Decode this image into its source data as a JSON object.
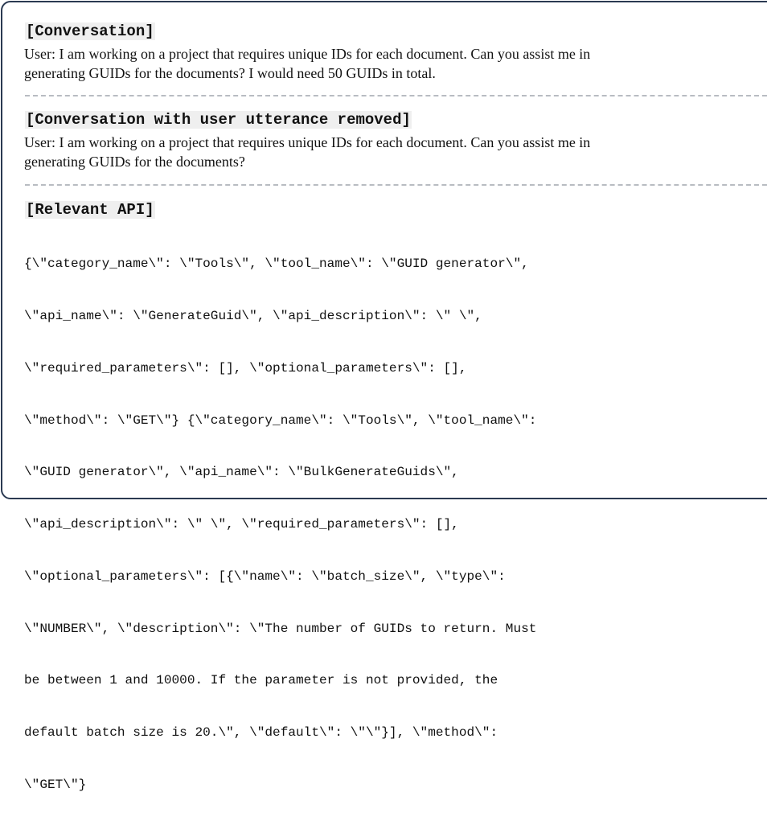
{
  "conversation": {
    "heading": "[Conversation]",
    "lines": [
      "User: I am working on a project that requires unique IDs for each document. Can you assist me in",
      "generating GUIDs for the documents? I would need 50 GUIDs in total."
    ]
  },
  "conversation_removed": {
    "heading": "[Conversation with user utterance removed]",
    "lines": [
      "User: I am working on a project that requires unique IDs for each document. Can you assist me in",
      "generating GUIDs for the documents?"
    ]
  },
  "relevant_api": {
    "heading": "[Relevant API]",
    "lines": [
      "{\\\"category_name\\\": \\\"Tools\\\", \\\"tool_name\\\": \\\"GUID generator\\\",",
      "\\\"api_name\\\": \\\"GenerateGuid\\\", \\\"api_description\\\": \\\" \\\",",
      "\\\"required_parameters\\\": [], \\\"optional_parameters\\\": [],",
      "\\\"method\\\": \\\"GET\\\"} {\\\"category_name\\\": \\\"Tools\\\", \\\"tool_name\\\":",
      "\\\"GUID generator\\\", \\\"api_name\\\": \\\"BulkGenerateGuids\\\",",
      "\\\"api_description\\\": \\\" \\\", \\\"required_parameters\\\": [],",
      "\\\"optional_parameters\\\": [{\\\"name\\\": \\\"batch_size\\\", \\\"type\\\":",
      "\\\"NUMBER\\\", \\\"description\\\": \\\"The number of GUIDs to return. Must",
      "be between 1 and 10000. If the parameter is not provided, the",
      "default batch size is 20.\\\", \\\"default\\\": \\\"\\\"}], \\\"method\\\":",
      "\\\"GET\\\"}"
    ]
  }
}
